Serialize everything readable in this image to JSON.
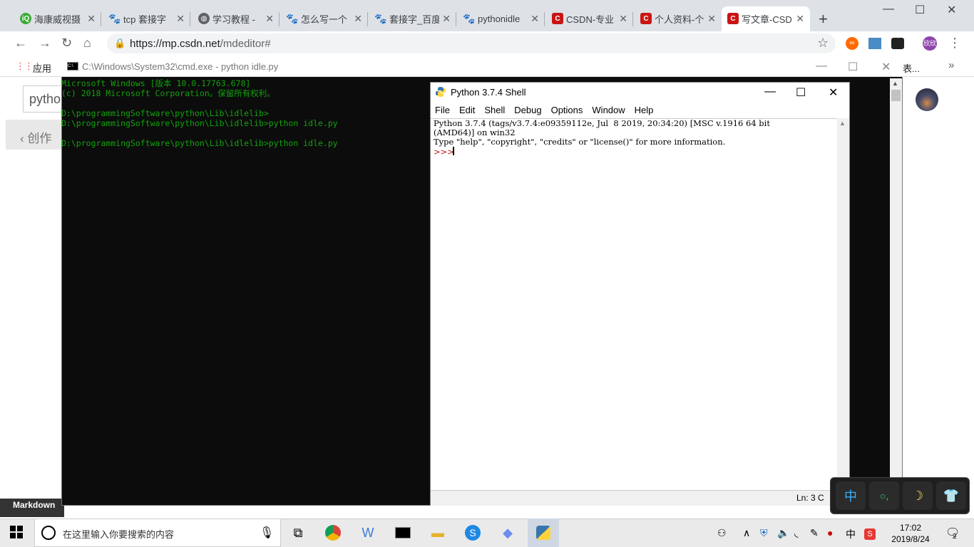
{
  "browser": {
    "tabs": [
      {
        "label": "海康威视摄",
        "icon": "iqiyi-icon"
      },
      {
        "label": "tcp 套接字",
        "icon": "baidu-paw-icon"
      },
      {
        "label": "学习教程 -",
        "icon": "globe-icon"
      },
      {
        "label": "怎么写一个",
        "icon": "baidu-paw-icon"
      },
      {
        "label": "套接字_百度",
        "icon": "baidu-paw-icon"
      },
      {
        "label": "pythonidle",
        "icon": "baidu-paw-icon"
      },
      {
        "label": "CSDN-专业",
        "icon": "csdn-icon"
      },
      {
        "label": "个人资料-个",
        "icon": "csdn-icon"
      },
      {
        "label": "写文章-CSD",
        "icon": "csdn-icon",
        "active": true
      }
    ],
    "url_host": "https://mp.csdn.net",
    "url_path": "/mdeditor#",
    "bookmarks_apps": "应用",
    "bookmark_overflow": "表...",
    "page_search_text": "pytho",
    "page_back_text": "创作",
    "page_markdown": "Markdown"
  },
  "cmd": {
    "title": "C:\\Windows\\System32\\cmd.exe - python  idle.py",
    "lines": "Microsoft Windows [版本 10.0.17763.678]\n(c) 2018 Microsoft Corporation。保留所有权利。\n\nD:\\programmingSoftware\\python\\Lib\\idlelib>\nD:\\programmingSoftware\\python\\Lib\\idlelib>python idle.py\n\nD:\\programmingSoftware\\python\\Lib\\idlelib>python idle.py"
  },
  "idle": {
    "title": "Python 3.7.4 Shell",
    "menu": [
      "File",
      "Edit",
      "Shell",
      "Debug",
      "Options",
      "Window",
      "Help"
    ],
    "banner": "Python 3.7.4 (tags/v3.7.4:e09359112e, Jul  8 2019, 20:34:20) [MSC v.1916 64 bit\n(AMD64)] on win32\nType \"help\", \"copyright\", \"credits\" or \"license()\" for more information.",
    "prompt": ">>>",
    "status": "Ln: 3   C"
  },
  "ime": {
    "buttons": [
      "中",
      "○,",
      "☽",
      "👕"
    ]
  },
  "taskbar": {
    "search_placeholder": "在这里输入你要搜索的内容",
    "ime_mode": "中",
    "time": "17:02",
    "date": "2019/8/24",
    "notification_count": "2"
  }
}
